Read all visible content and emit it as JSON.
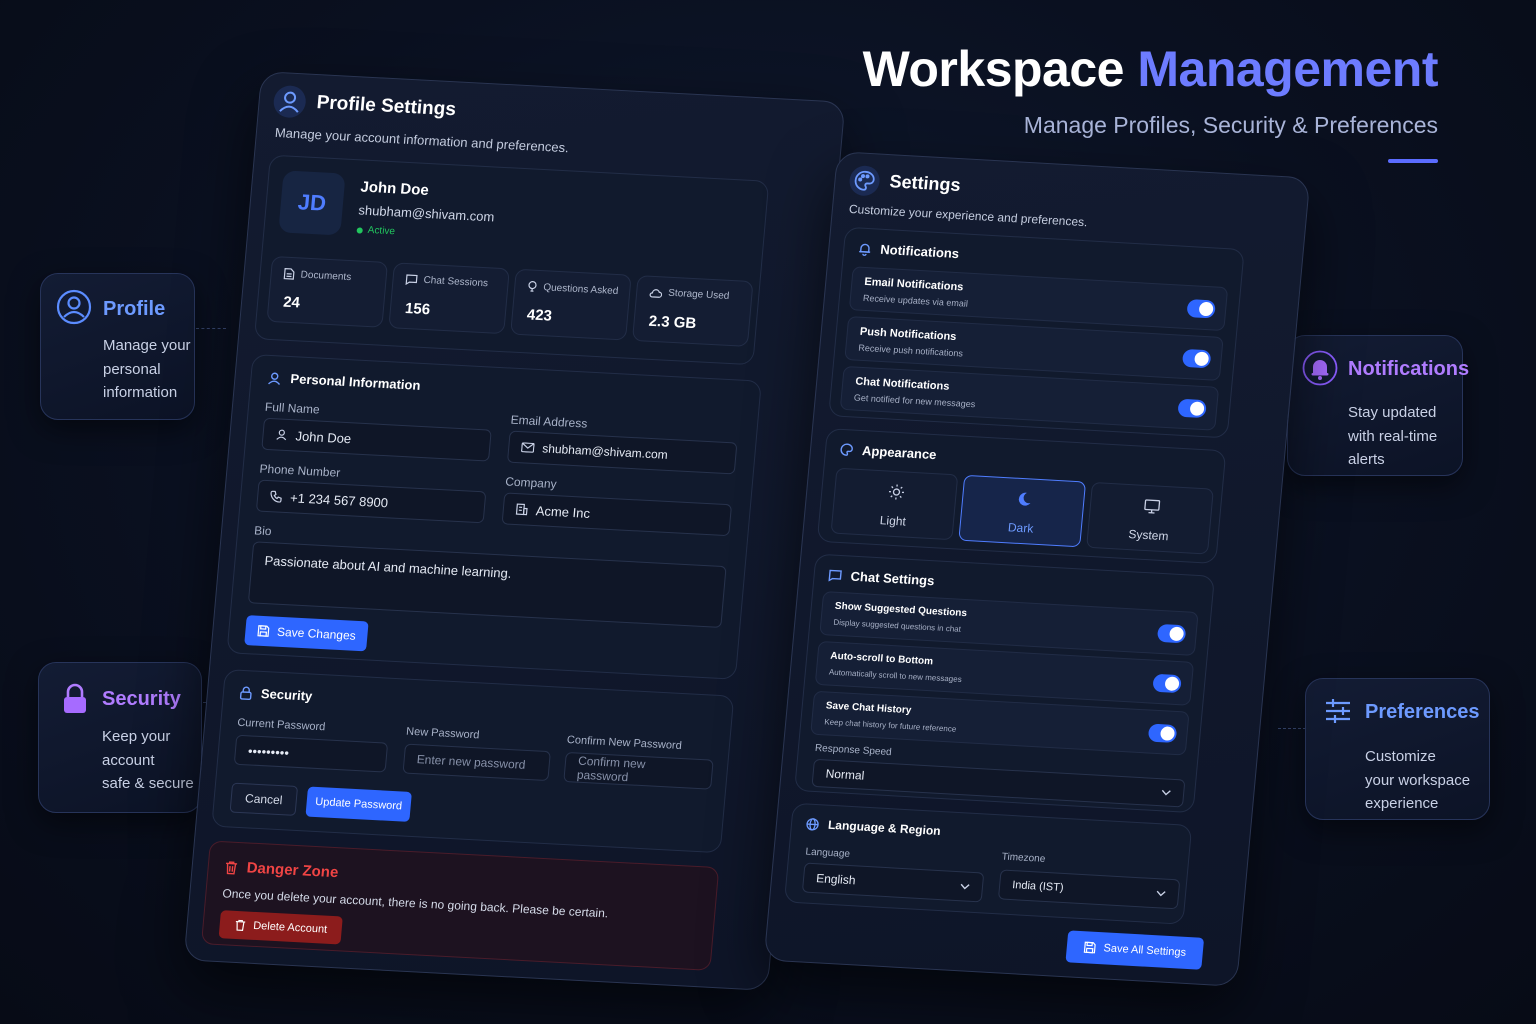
{
  "header": {
    "title_main": "Workspace",
    "title_accent": "Management",
    "subtitle": "Manage Profiles, Security & Preferences"
  },
  "callouts": {
    "profile": {
      "title": "Profile",
      "lines": [
        "Manage your",
        "personal",
        "information"
      ],
      "icon": "user-icon",
      "color": "#5b8cff"
    },
    "security": {
      "title": "Security",
      "lines": [
        "Keep your",
        "account",
        "safe & secure"
      ],
      "icon": "lock-icon",
      "color": "#a66bff"
    },
    "notifications": {
      "title": "Notifications",
      "lines": [
        "Stay updated",
        "with real-time",
        "alerts"
      ],
      "icon": "bell-icon",
      "color": "#a66bff"
    },
    "preferences": {
      "title": "Preferences",
      "lines": [
        "Customize",
        "your workspace",
        "experience"
      ],
      "icon": "sliders-icon",
      "color": "#5b8cff"
    }
  },
  "profile_card": {
    "title": "Profile Settings",
    "subtitle": "Manage your account information and preferences.",
    "user": {
      "initials": "JD",
      "name": "John Doe",
      "email": "shubham@shivam.com",
      "status": "Active"
    },
    "stats": [
      {
        "label": "Documents",
        "value": "24",
        "icon": "document-icon"
      },
      {
        "label": "Chat Sessions",
        "value": "156",
        "icon": "chat-icon"
      },
      {
        "label": "Questions Asked",
        "value": "423",
        "icon": "lightbulb-icon"
      },
      {
        "label": "Storage Used",
        "value": "2.3 GB",
        "icon": "cloud-icon"
      }
    ],
    "personal": {
      "title": "Personal Information",
      "full_name_label": "Full Name",
      "full_name": "John Doe",
      "email_label": "Email Address",
      "email": "shubham@shivam.com",
      "phone_label": "Phone Number",
      "phone": "+1 234 567 8900",
      "company_label": "Company",
      "company": "Acme Inc",
      "bio_label": "Bio",
      "bio": "Passionate about AI and machine learning.",
      "save_label": "Save Changes"
    },
    "security": {
      "title": "Security",
      "current_label": "Current Password",
      "current_value": "•••••••••",
      "new_label": "New Password",
      "new_placeholder": "Enter new password",
      "confirm_label": "Confirm New Password",
      "confirm_placeholder": "Confirm new password",
      "cancel_label": "Cancel",
      "update_label": "Update Password"
    },
    "danger": {
      "title": "Danger Zone",
      "text": "Once you delete your account, there is no going back. Please be certain.",
      "delete_label": "Delete Account"
    }
  },
  "settings_card": {
    "title": "Settings",
    "subtitle": "Customize your experience and preferences.",
    "notifications": {
      "title": "Notifications",
      "items": [
        {
          "title": "Email Notifications",
          "sub": "Receive updates via email",
          "enabled": true
        },
        {
          "title": "Push Notifications",
          "sub": "Receive push notifications",
          "enabled": true
        },
        {
          "title": "Chat Notifications",
          "sub": "Get notified for new messages",
          "enabled": true
        }
      ]
    },
    "appearance": {
      "title": "Appearance",
      "options": [
        "Light",
        "Dark",
        "System"
      ],
      "selected": "Dark"
    },
    "chat": {
      "title": "Chat Settings",
      "items": [
        {
          "title": "Show Suggested Questions",
          "sub": "Display suggested questions in chat",
          "enabled": true
        },
        {
          "title": "Auto-scroll to Bottom",
          "sub": "Automatically scroll to new messages",
          "enabled": true
        },
        {
          "title": "Save Chat History",
          "sub": "Keep chat history for future reference",
          "enabled": true
        }
      ],
      "speed_label": "Response Speed",
      "speed_value": "Normal"
    },
    "language": {
      "title": "Language & Region",
      "lang_label": "Language",
      "lang_value": "English",
      "tz_label": "Timezone",
      "tz_value": "India (IST)"
    },
    "save_label": "Save All Settings"
  },
  "colors": {
    "accent": "#2e66ff",
    "brand": "#6d7cff",
    "active": "#22c55e",
    "danger": "#ef4444"
  }
}
